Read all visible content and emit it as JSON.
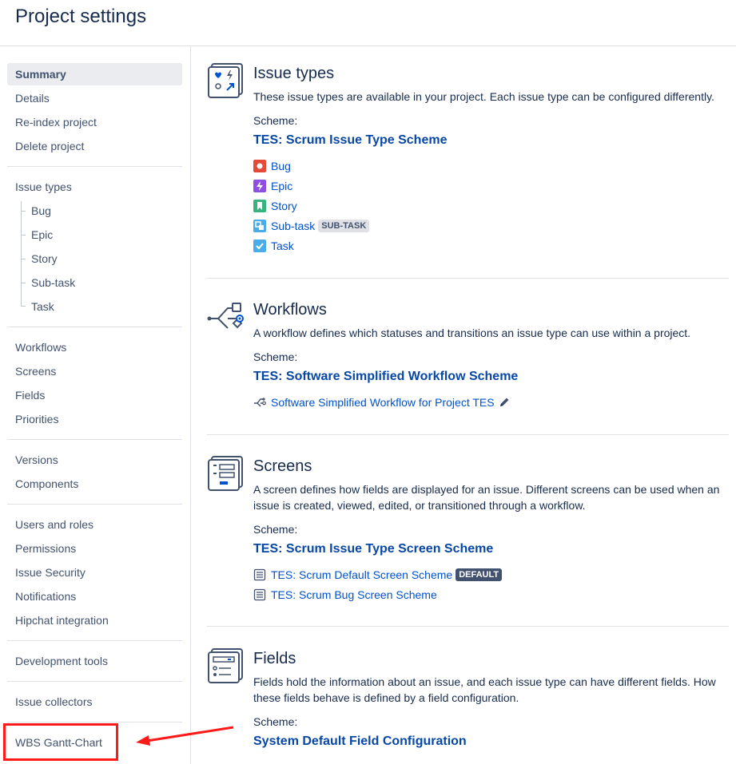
{
  "page": {
    "title": "Project settings"
  },
  "sidebar": {
    "items": [
      {
        "label": "Summary"
      },
      {
        "label": "Details"
      },
      {
        "label": "Re-index project"
      },
      {
        "label": "Delete project"
      },
      {
        "label": "Issue types"
      },
      {
        "label": "Bug"
      },
      {
        "label": "Epic"
      },
      {
        "label": "Story"
      },
      {
        "label": "Sub-task"
      },
      {
        "label": "Task"
      },
      {
        "label": "Workflows"
      },
      {
        "label": "Screens"
      },
      {
        "label": "Fields"
      },
      {
        "label": "Priorities"
      },
      {
        "label": "Versions"
      },
      {
        "label": "Components"
      },
      {
        "label": "Users and roles"
      },
      {
        "label": "Permissions"
      },
      {
        "label": "Issue Security"
      },
      {
        "label": "Notifications"
      },
      {
        "label": "Hipchat integration"
      },
      {
        "label": "Development tools"
      },
      {
        "label": "Issue collectors"
      },
      {
        "label": "WBS Gantt-Chart"
      }
    ]
  },
  "issue_types": {
    "title": "Issue types",
    "description": "These issue types are available in your project. Each issue type can be configured differently.",
    "scheme_label": "Scheme:",
    "scheme_name": "TES: Scrum Issue Type Scheme",
    "types": [
      {
        "label": "Bug",
        "icon": "bug-icon",
        "color": "#e5493a"
      },
      {
        "label": "Epic",
        "icon": "epic-icon",
        "color": "#904ee2"
      },
      {
        "label": "Story",
        "icon": "story-icon",
        "color": "#36b37e"
      },
      {
        "label": "Sub-task",
        "icon": "subtask-icon",
        "color": "#4bade8",
        "badge": "SUB-TASK"
      },
      {
        "label": "Task",
        "icon": "task-icon",
        "color": "#4bade8"
      }
    ]
  },
  "workflows": {
    "title": "Workflows",
    "description": "A workflow defines which statuses and transitions an issue type can use within a project.",
    "scheme_label": "Scheme:",
    "scheme_name": "TES: Software Simplified Workflow Scheme",
    "items": [
      {
        "label": "Software Simplified Workflow for Project TES"
      }
    ]
  },
  "screens": {
    "title": "Screens",
    "description": "A screen defines how fields are displayed for an issue. Different screens can be used when an issue is created, viewed, edited, or transitioned through a workflow.",
    "scheme_label": "Scheme:",
    "scheme_name": "TES: Scrum Issue Type Screen Scheme",
    "items": [
      {
        "label": "TES: Scrum Default Screen Scheme",
        "badge": "DEFAULT"
      },
      {
        "label": "TES: Scrum Bug Screen Scheme"
      }
    ]
  },
  "fields": {
    "title": "Fields",
    "description": "Fields hold the information about an issue, and each issue type can have different fields. How these fields behave is defined by a field configuration.",
    "scheme_label": "Scheme:",
    "scheme_name": "System Default Field Configuration"
  },
  "colors": {
    "link": "#0052cc",
    "scheme_link": "#0747a6",
    "annotation": "#ff1a1a",
    "text": "#172b4d"
  }
}
